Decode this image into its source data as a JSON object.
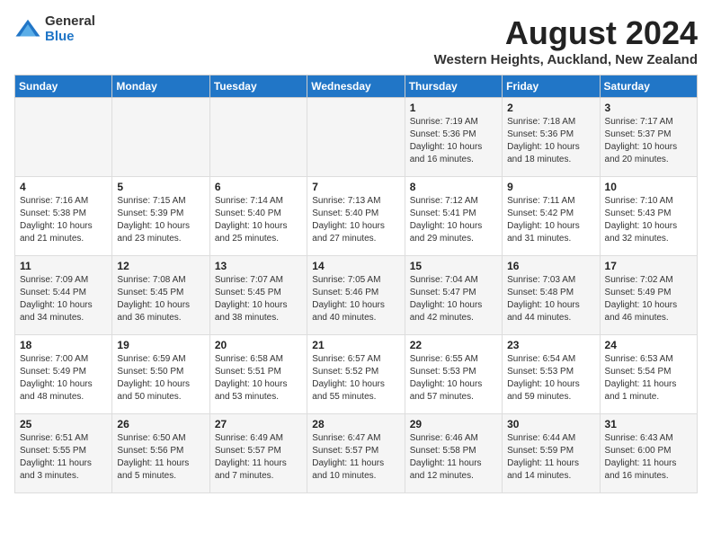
{
  "logo": {
    "general": "General",
    "blue": "Blue"
  },
  "title": "August 2024",
  "subtitle": "Western Heights, Auckland, New Zealand",
  "days_header": [
    "Sunday",
    "Monday",
    "Tuesday",
    "Wednesday",
    "Thursday",
    "Friday",
    "Saturday"
  ],
  "weeks": [
    [
      {
        "day": "",
        "info": ""
      },
      {
        "day": "",
        "info": ""
      },
      {
        "day": "",
        "info": ""
      },
      {
        "day": "",
        "info": ""
      },
      {
        "day": "1",
        "info": "Sunrise: 7:19 AM\nSunset: 5:36 PM\nDaylight: 10 hours\nand 16 minutes."
      },
      {
        "day": "2",
        "info": "Sunrise: 7:18 AM\nSunset: 5:36 PM\nDaylight: 10 hours\nand 18 minutes."
      },
      {
        "day": "3",
        "info": "Sunrise: 7:17 AM\nSunset: 5:37 PM\nDaylight: 10 hours\nand 20 minutes."
      }
    ],
    [
      {
        "day": "4",
        "info": "Sunrise: 7:16 AM\nSunset: 5:38 PM\nDaylight: 10 hours\nand 21 minutes."
      },
      {
        "day": "5",
        "info": "Sunrise: 7:15 AM\nSunset: 5:39 PM\nDaylight: 10 hours\nand 23 minutes."
      },
      {
        "day": "6",
        "info": "Sunrise: 7:14 AM\nSunset: 5:40 PM\nDaylight: 10 hours\nand 25 minutes."
      },
      {
        "day": "7",
        "info": "Sunrise: 7:13 AM\nSunset: 5:40 PM\nDaylight: 10 hours\nand 27 minutes."
      },
      {
        "day": "8",
        "info": "Sunrise: 7:12 AM\nSunset: 5:41 PM\nDaylight: 10 hours\nand 29 minutes."
      },
      {
        "day": "9",
        "info": "Sunrise: 7:11 AM\nSunset: 5:42 PM\nDaylight: 10 hours\nand 31 minutes."
      },
      {
        "day": "10",
        "info": "Sunrise: 7:10 AM\nSunset: 5:43 PM\nDaylight: 10 hours\nand 32 minutes."
      }
    ],
    [
      {
        "day": "11",
        "info": "Sunrise: 7:09 AM\nSunset: 5:44 PM\nDaylight: 10 hours\nand 34 minutes."
      },
      {
        "day": "12",
        "info": "Sunrise: 7:08 AM\nSunset: 5:45 PM\nDaylight: 10 hours\nand 36 minutes."
      },
      {
        "day": "13",
        "info": "Sunrise: 7:07 AM\nSunset: 5:45 PM\nDaylight: 10 hours\nand 38 minutes."
      },
      {
        "day": "14",
        "info": "Sunrise: 7:05 AM\nSunset: 5:46 PM\nDaylight: 10 hours\nand 40 minutes."
      },
      {
        "day": "15",
        "info": "Sunrise: 7:04 AM\nSunset: 5:47 PM\nDaylight: 10 hours\nand 42 minutes."
      },
      {
        "day": "16",
        "info": "Sunrise: 7:03 AM\nSunset: 5:48 PM\nDaylight: 10 hours\nand 44 minutes."
      },
      {
        "day": "17",
        "info": "Sunrise: 7:02 AM\nSunset: 5:49 PM\nDaylight: 10 hours\nand 46 minutes."
      }
    ],
    [
      {
        "day": "18",
        "info": "Sunrise: 7:00 AM\nSunset: 5:49 PM\nDaylight: 10 hours\nand 48 minutes."
      },
      {
        "day": "19",
        "info": "Sunrise: 6:59 AM\nSunset: 5:50 PM\nDaylight: 10 hours\nand 50 minutes."
      },
      {
        "day": "20",
        "info": "Sunrise: 6:58 AM\nSunset: 5:51 PM\nDaylight: 10 hours\nand 53 minutes."
      },
      {
        "day": "21",
        "info": "Sunrise: 6:57 AM\nSunset: 5:52 PM\nDaylight: 10 hours\nand 55 minutes."
      },
      {
        "day": "22",
        "info": "Sunrise: 6:55 AM\nSunset: 5:53 PM\nDaylight: 10 hours\nand 57 minutes."
      },
      {
        "day": "23",
        "info": "Sunrise: 6:54 AM\nSunset: 5:53 PM\nDaylight: 10 hours\nand 59 minutes."
      },
      {
        "day": "24",
        "info": "Sunrise: 6:53 AM\nSunset: 5:54 PM\nDaylight: 11 hours\nand 1 minute."
      }
    ],
    [
      {
        "day": "25",
        "info": "Sunrise: 6:51 AM\nSunset: 5:55 PM\nDaylight: 11 hours\nand 3 minutes."
      },
      {
        "day": "26",
        "info": "Sunrise: 6:50 AM\nSunset: 5:56 PM\nDaylight: 11 hours\nand 5 minutes."
      },
      {
        "day": "27",
        "info": "Sunrise: 6:49 AM\nSunset: 5:57 PM\nDaylight: 11 hours\nand 7 minutes."
      },
      {
        "day": "28",
        "info": "Sunrise: 6:47 AM\nSunset: 5:57 PM\nDaylight: 11 hours\nand 10 minutes."
      },
      {
        "day": "29",
        "info": "Sunrise: 6:46 AM\nSunset: 5:58 PM\nDaylight: 11 hours\nand 12 minutes."
      },
      {
        "day": "30",
        "info": "Sunrise: 6:44 AM\nSunset: 5:59 PM\nDaylight: 11 hours\nand 14 minutes."
      },
      {
        "day": "31",
        "info": "Sunrise: 6:43 AM\nSunset: 6:00 PM\nDaylight: 11 hours\nand 16 minutes."
      }
    ]
  ]
}
